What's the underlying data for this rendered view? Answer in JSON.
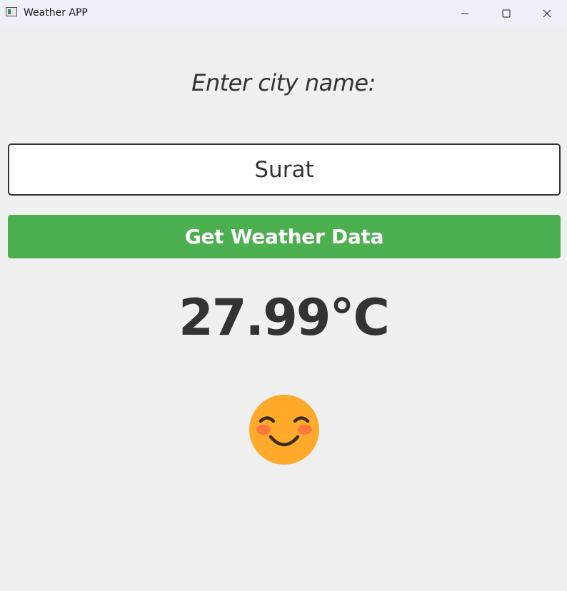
{
  "window": {
    "title": "Weather APP",
    "icon": "app-window-icon",
    "controls": [
      "minimize-icon",
      "maximize-icon",
      "close-icon"
    ]
  },
  "prompt": {
    "label": "Enter city name:"
  },
  "city_input": {
    "value": "Surat"
  },
  "button": {
    "label": "Get Weather Data",
    "color": "#4caf50"
  },
  "weather": {
    "temperature": "27.99°C",
    "emoji": "smiling-face-with-smiling-eyes"
  },
  "colors": {
    "background": "#f0f0f0",
    "text": "#333333",
    "accent": "#4caf50",
    "emoji_face": "#ffaa2b"
  }
}
